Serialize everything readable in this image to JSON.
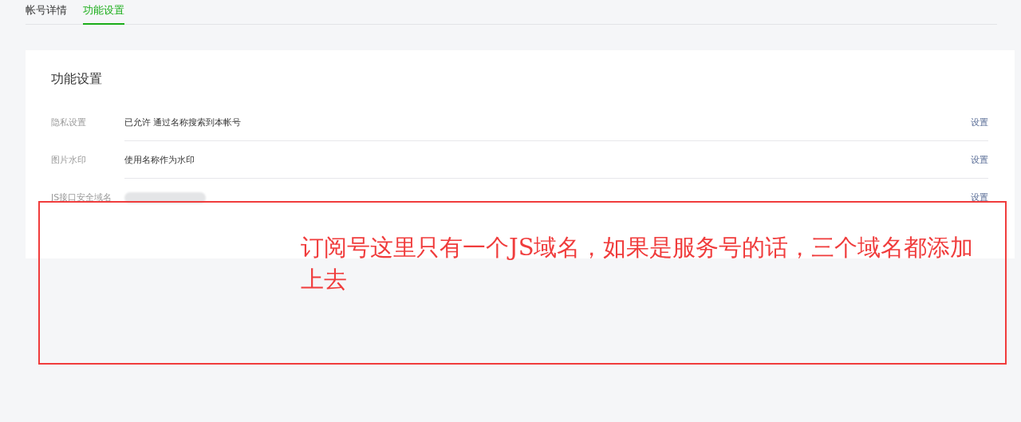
{
  "tabs": [
    {
      "label": "帐号详情",
      "selected": false
    },
    {
      "label": "功能设置",
      "selected": true
    }
  ],
  "panel": {
    "title": "功能设置",
    "rows": [
      {
        "label": "隐私设置",
        "value": "已允许 通过名称搜索到本帐号",
        "action": "设置",
        "kind": "text"
      },
      {
        "label": "图片水印",
        "value": "使用名称作为水印",
        "action": "设置",
        "kind": "text"
      },
      {
        "label": "JS接口安全域名",
        "action": "设置",
        "kind": "redacted"
      }
    ]
  },
  "annotation": {
    "text": "订阅号这里只有一个JS域名，如果是服务号的话，三个域名都添加上去"
  }
}
